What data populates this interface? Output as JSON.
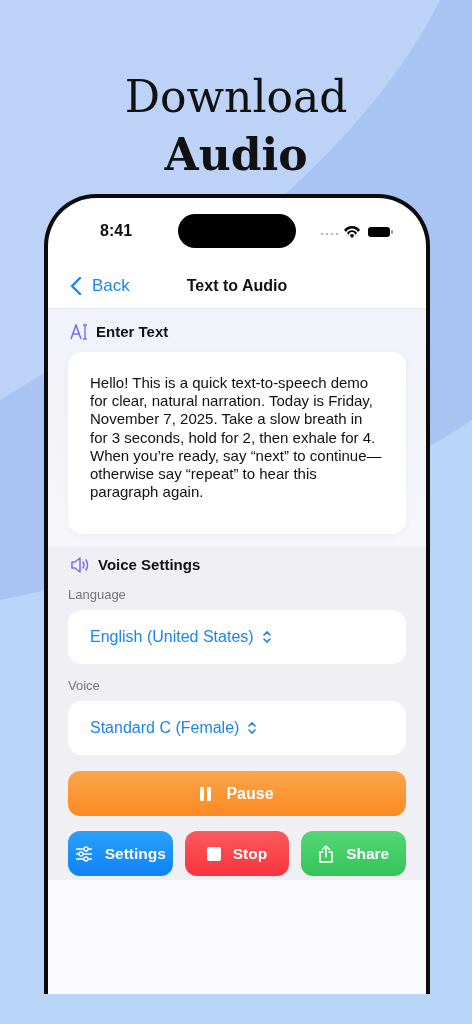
{
  "headline": "Download **Audio**",
  "status_bar": {
    "time": "8:41"
  },
  "nav": {
    "back": "Back",
    "title": "Text to Audio"
  },
  "text_section": {
    "title": "Enter Text",
    "value": "Hello! This is a quick text-to-speech demo for clear, natural narration. Today is Friday, November 7, 2025. Take a slow breath in for 3 seconds, hold for 2, then exhale for 4. When you’re ready, say “next” to continue—otherwise say “repeat” to hear this paragraph again."
  },
  "voice_section": {
    "title": "Voice Settings",
    "fields": [
      {
        "label": "Language",
        "value": "English (United States)"
      },
      {
        "label": "Voice",
        "value": "Standard C (Female)"
      }
    ]
  },
  "primary_button": {
    "label": "Pause"
  },
  "buttons": [
    {
      "kind": "settings",
      "label": "Settings"
    },
    {
      "kind": "stop",
      "label": "Stop"
    },
    {
      "kind": "share",
      "label": "Share"
    }
  ]
}
